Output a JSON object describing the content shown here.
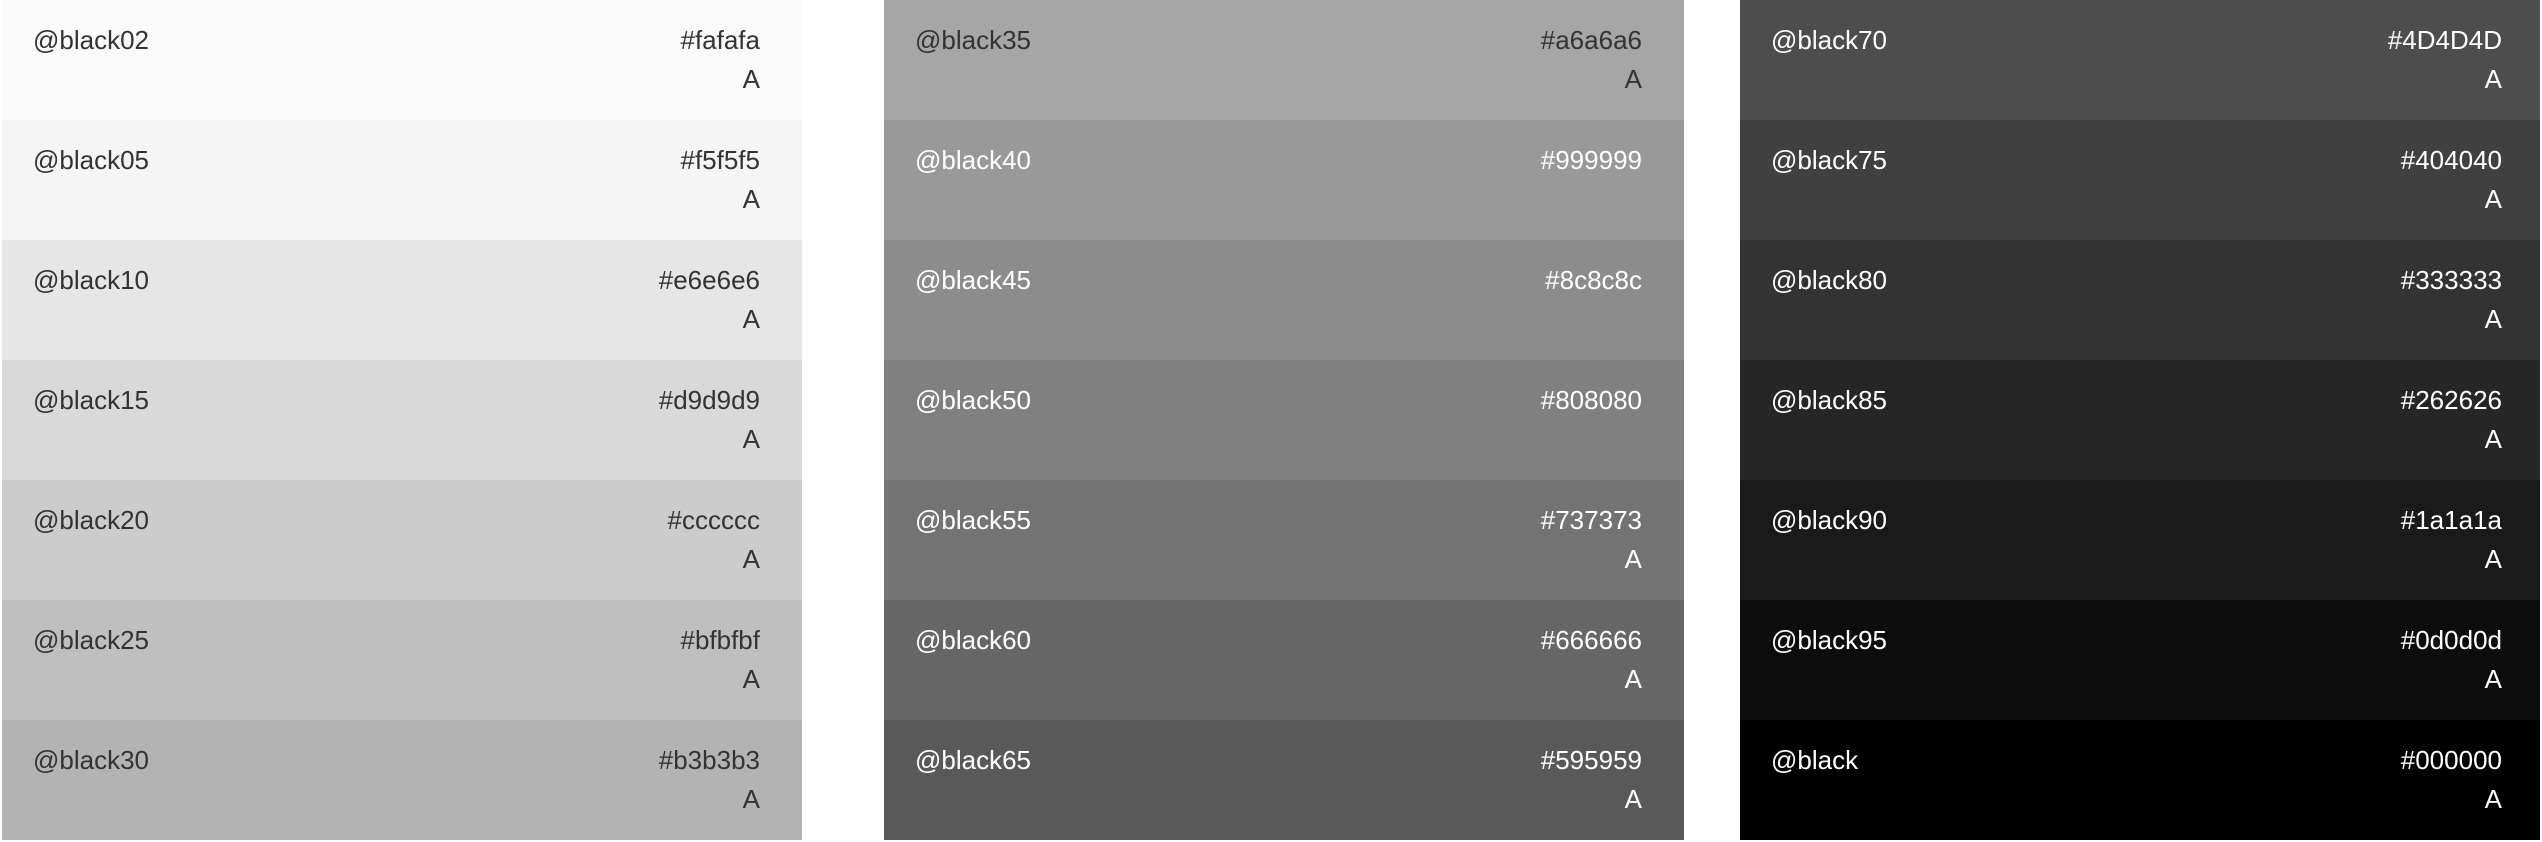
{
  "palette": {
    "columns": [
      {
        "swatches": [
          {
            "name": "@black02",
            "hex": "#fafafa",
            "sample": "A",
            "bg": "#fafafa",
            "fg": "#333333"
          },
          {
            "name": "@black05",
            "hex": "#f5f5f5",
            "sample": "A",
            "bg": "#f5f5f5",
            "fg": "#333333"
          },
          {
            "name": "@black10",
            "hex": "#e6e6e6",
            "sample": "A",
            "bg": "#e6e6e6",
            "fg": "#333333"
          },
          {
            "name": "@black15",
            "hex": "#d9d9d9",
            "sample": "A",
            "bg": "#d9d9d9",
            "fg": "#333333"
          },
          {
            "name": "@black20",
            "hex": "#cccccc",
            "sample": "A",
            "bg": "#cccccc",
            "fg": "#333333"
          },
          {
            "name": "@black25",
            "hex": "#bfbfbf",
            "sample": "A",
            "bg": "#bfbfbf",
            "fg": "#333333"
          },
          {
            "name": "@black30",
            "hex": "#b3b3b3",
            "sample": "A",
            "bg": "#b3b3b3",
            "fg": "#333333"
          }
        ]
      },
      {
        "swatches": [
          {
            "name": "@black35",
            "hex": "#a6a6a6",
            "sample": "A",
            "bg": "#a6a6a6",
            "fg": "#333333"
          },
          {
            "name": "@black40",
            "hex": "#999999",
            "sample": "",
            "bg": "#999999",
            "fg": "#ffffff"
          },
          {
            "name": "@black45",
            "hex": "#8c8c8c",
            "sample": "",
            "bg": "#8c8c8c",
            "fg": "#ffffff"
          },
          {
            "name": "@black50",
            "hex": "#808080",
            "sample": "",
            "bg": "#808080",
            "fg": "#ffffff"
          },
          {
            "name": "@black55",
            "hex": "#737373",
            "sample": "A",
            "bg": "#737373",
            "fg": "#ffffff"
          },
          {
            "name": "@black60",
            "hex": "#666666",
            "sample": "A",
            "bg": "#666666",
            "fg": "#ffffff"
          },
          {
            "name": "@black65",
            "hex": "#595959",
            "sample": "A",
            "bg": "#595959",
            "fg": "#ffffff"
          }
        ]
      },
      {
        "swatches": [
          {
            "name": "@black70",
            "hex": "#4D4D4D",
            "sample": "A",
            "bg": "#4d4d4d",
            "fg": "#ffffff"
          },
          {
            "name": "@black75",
            "hex": "#404040",
            "sample": "A",
            "bg": "#404040",
            "fg": "#ffffff"
          },
          {
            "name": "@black80",
            "hex": "#333333",
            "sample": "A",
            "bg": "#333333",
            "fg": "#ffffff"
          },
          {
            "name": "@black85",
            "hex": "#262626",
            "sample": "A",
            "bg": "#262626",
            "fg": "#ffffff"
          },
          {
            "name": "@black90",
            "hex": "#1a1a1a",
            "sample": "A",
            "bg": "#1a1a1a",
            "fg": "#ffffff"
          },
          {
            "name": "@black95",
            "hex": "#0d0d0d",
            "sample": "A",
            "bg": "#0d0d0d",
            "fg": "#ffffff"
          },
          {
            "name": "@black",
            "hex": "#000000",
            "sample": "A",
            "bg": "#000000",
            "fg": "#ffffff"
          }
        ]
      }
    ]
  }
}
